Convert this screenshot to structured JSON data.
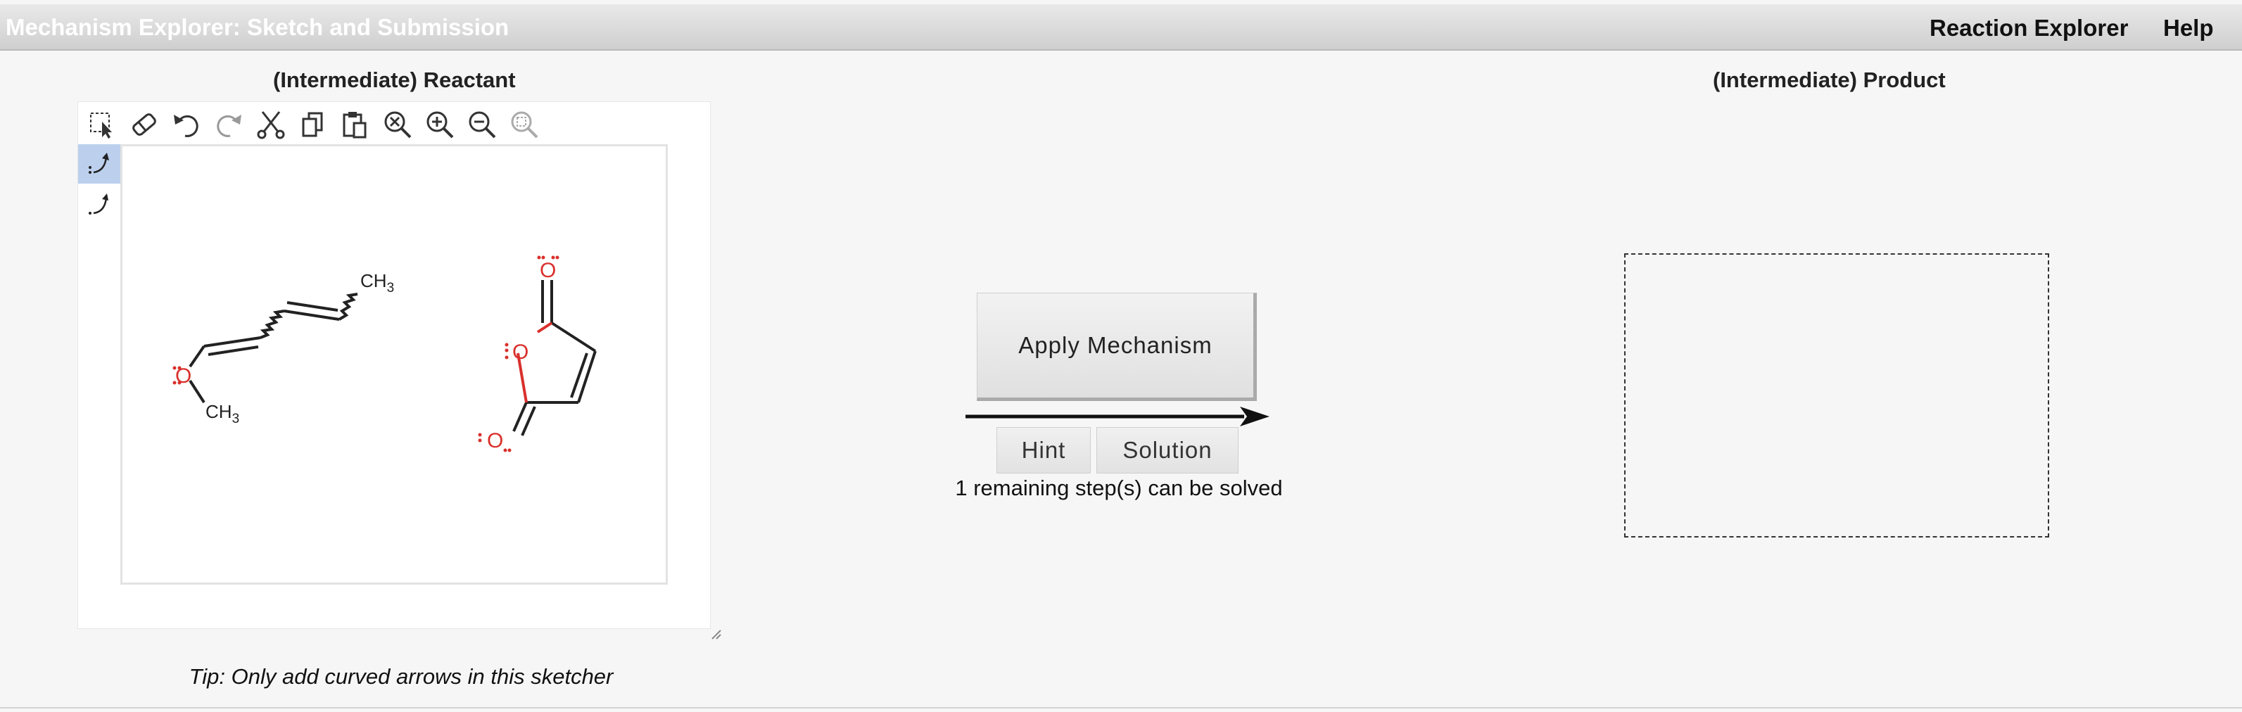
{
  "header": {
    "title": "Mechanism Explorer: Sketch and Submission",
    "links": [
      "Reaction Explorer",
      "Help"
    ]
  },
  "reactant": {
    "heading": "(Intermediate) Reactant",
    "toolbar_icons": [
      "select-icon",
      "eraser-icon",
      "undo-icon",
      "redo-icon",
      "cut-icon",
      "copy-icon",
      "paste-icon",
      "zoom-reset-icon",
      "zoom-in-icon",
      "zoom-out-icon",
      "zoom-fit-icon"
    ],
    "side_tools": [
      "electron-pair-arrow-icon",
      "single-electron-arrow-icon"
    ],
    "molecules": {
      "labels": [
        "CH3",
        "O",
        "CH3",
        "O",
        "O",
        "O"
      ]
    },
    "tip": "Tip: Only add curved arrows in this sketcher"
  },
  "mechanism": {
    "apply_label": "Apply Mechanism",
    "hint_label": "Hint",
    "solution_label": "Solution",
    "status": "1 remaining step(s) can be solved"
  },
  "product": {
    "heading": "(Intermediate) Product"
  },
  "colors": {
    "atom_red": "#d9302c",
    "bond_black": "#222222",
    "active_tool": "#bcd0ee"
  }
}
